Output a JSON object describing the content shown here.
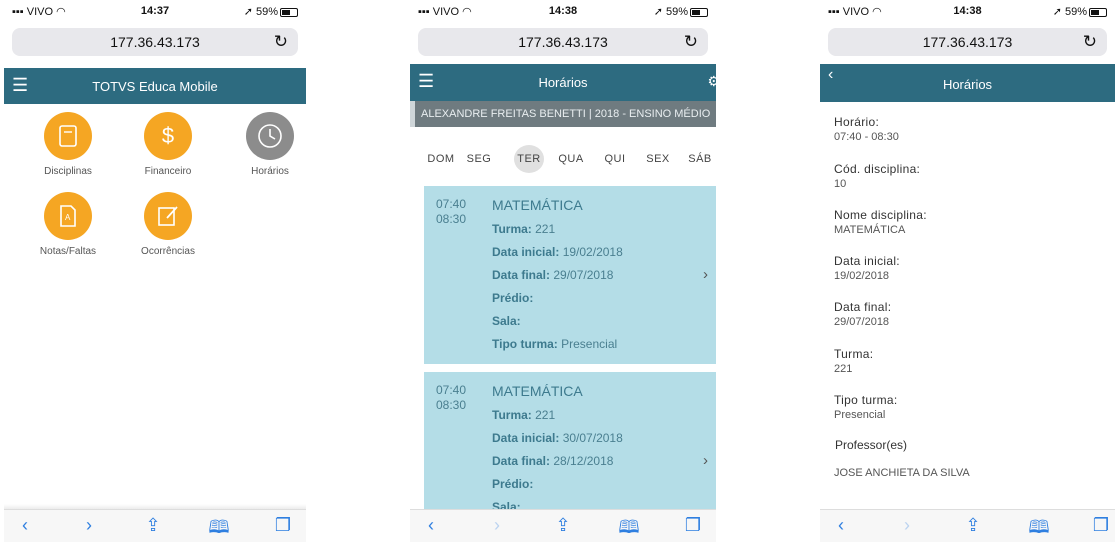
{
  "colors": {
    "header": "#2d6b80",
    "accent": "#f5a623",
    "card": "#b4dde7",
    "ios_blue": "#2f7fe0"
  },
  "phone1": {
    "status": {
      "carrier": "VIVO",
      "time": "14:37",
      "battery": "59%"
    },
    "url": "177.36.43.173",
    "title": "TOTVS Educa Mobile",
    "apps": [
      {
        "label": "Disciplinas",
        "icon": "book-icon"
      },
      {
        "label": "Financeiro",
        "icon": "dollar-icon"
      },
      {
        "label": "Horários",
        "icon": "clock-icon"
      },
      {
        "label": "Notas/Faltas",
        "icon": "grades-icon"
      },
      {
        "label": "Ocorrências",
        "icon": "notepad-icon"
      }
    ]
  },
  "phone2": {
    "status": {
      "carrier": "VIVO",
      "time": "14:38",
      "battery": "59%"
    },
    "url": "177.36.43.173",
    "title": "Horários",
    "student": "ALEXANDRE FREITAS BENETTI | 2018 - ENSINO MÉDIO",
    "days": [
      "DOM",
      "SEG",
      "TER",
      "QUA",
      "QUI",
      "SEX",
      "SÁB"
    ],
    "selected_day": "TER",
    "cards": [
      {
        "start": "07:40",
        "end": "08:30",
        "subject": "MATEMÁTICA",
        "rows": [
          {
            "k": "Turma:",
            "v": "221"
          },
          {
            "k": "Data inicial:",
            "v": "19/02/2018"
          },
          {
            "k": "Data final:",
            "v": "29/07/2018"
          },
          {
            "k": "Prédio:",
            "v": ""
          },
          {
            "k": "Sala:",
            "v": ""
          },
          {
            "k": "Tipo turma:",
            "v": "Presencial"
          }
        ]
      },
      {
        "start": "07:40",
        "end": "08:30",
        "subject": "MATEMÁTICA",
        "rows": [
          {
            "k": "Turma:",
            "v": "221"
          },
          {
            "k": "Data inicial:",
            "v": "30/07/2018"
          },
          {
            "k": "Data final:",
            "v": "28/12/2018"
          },
          {
            "k": "Prédio:",
            "v": ""
          },
          {
            "k": "Sala:",
            "v": ""
          }
        ]
      }
    ]
  },
  "phone3": {
    "status": {
      "carrier": "VIVO",
      "time": "14:38",
      "battery": "59%"
    },
    "url": "177.36.43.173",
    "title": "Horários",
    "fields": [
      {
        "k": "Horário:",
        "v": "07:40 - 08:30"
      },
      {
        "k": "Cód. disciplina:",
        "v": "10"
      },
      {
        "k": "Nome disciplina:",
        "v": "MATEMÁTICA"
      },
      {
        "k": "Data inicial:",
        "v": "19/02/2018"
      },
      {
        "k": "Data final:",
        "v": "29/07/2018"
      },
      {
        "k": "Turma:",
        "v": "221"
      },
      {
        "k": "Tipo turma:",
        "v": "Presencial"
      }
    ],
    "professor_label": "Professor(es)",
    "professor": "JOSE ANCHIETA DA SILVA"
  },
  "toolbar_icons": [
    "back-icon",
    "forward-icon",
    "share-icon",
    "bookmarks-icon",
    "tabs-icon"
  ]
}
